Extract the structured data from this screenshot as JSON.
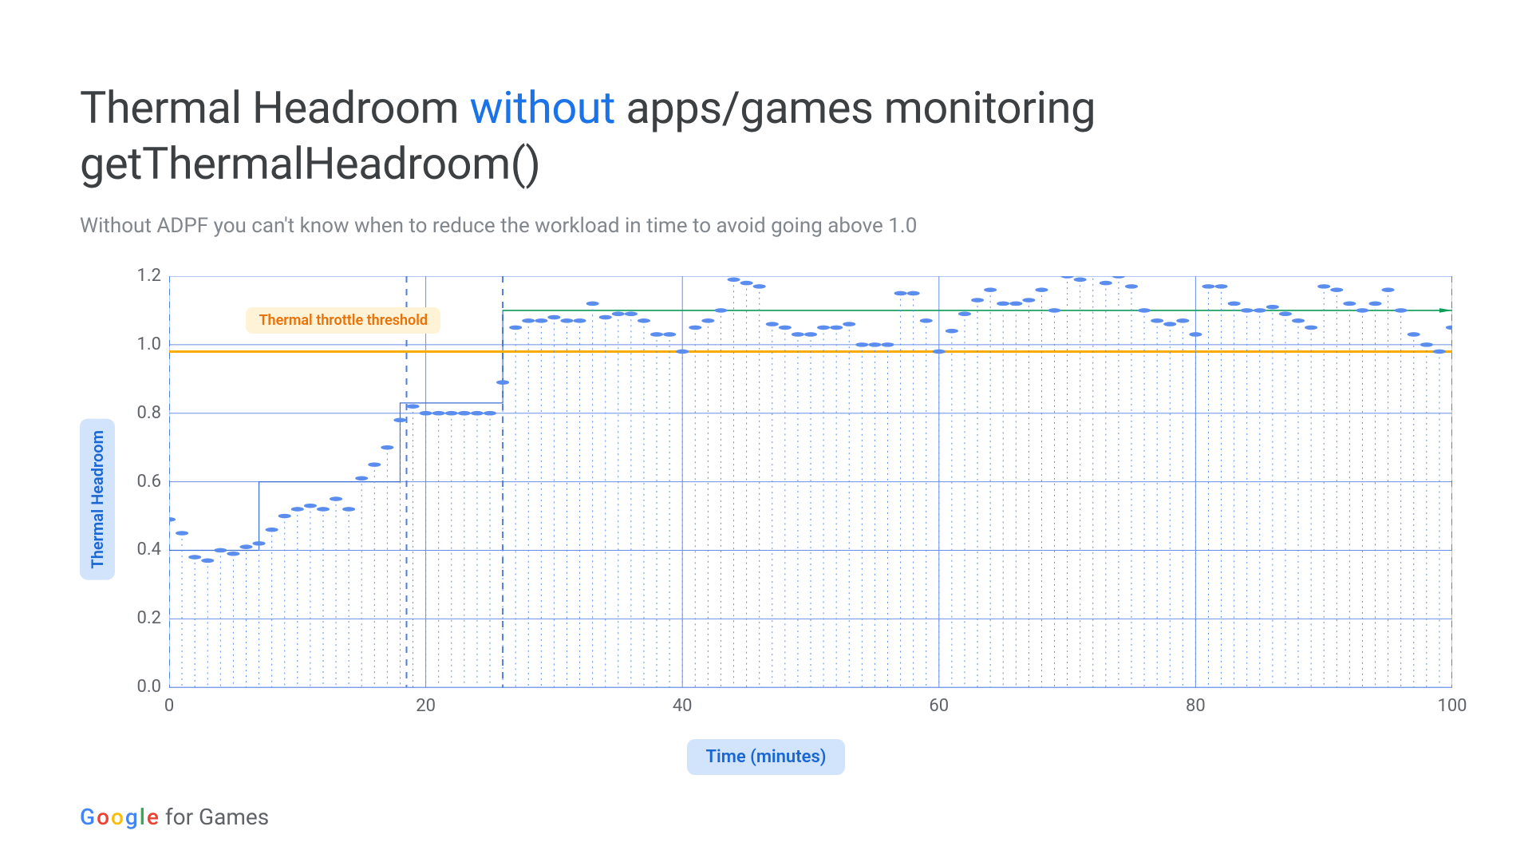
{
  "title_pre": "Thermal Headroom ",
  "title_accent": "without",
  "title_post": " apps/games monitoring getThermalHeadroom()",
  "subtitle": "Without ADPF you can't know when to reduce the workload in time to avoid going above 1.0",
  "ylabel": "Thermal Headroom",
  "xlabel": "Time (minutes)",
  "threshold_label": "Thermal throttle threshold",
  "footer_rest": "for Games",
  "chart_data": {
    "type": "scatter",
    "xlabel": "Time (minutes)",
    "ylabel": "Thermal Headroom",
    "xlim": [
      0,
      100
    ],
    "ylim": [
      0.0,
      1.2
    ],
    "xticks": [
      0,
      20,
      40,
      60,
      80,
      100
    ],
    "yticks": [
      0.0,
      0.2,
      0.4,
      0.6,
      0.8,
      1.0,
      1.2
    ],
    "threshold_y": 0.98,
    "threshold_label": "Thermal throttle threshold",
    "plateau_segments": [
      {
        "x0": 0,
        "x1": 7,
        "y": 0.4
      },
      {
        "x0": 7,
        "x1": 18,
        "y": 0.6
      },
      {
        "x0": 18,
        "x1": 26,
        "y": 0.83
      },
      {
        "x0": 26,
        "x1": 100,
        "y": 1.1
      }
    ],
    "region_markers_x": [
      0,
      18.5,
      26,
      100
    ],
    "x": [
      0,
      1,
      2,
      3,
      4,
      5,
      6,
      7,
      8,
      9,
      10,
      11,
      12,
      13,
      14,
      15,
      16,
      17,
      18,
      19,
      20,
      21,
      22,
      23,
      24,
      25,
      26,
      27,
      28,
      29,
      30,
      31,
      32,
      33,
      34,
      35,
      36,
      37,
      38,
      39,
      40,
      41,
      42,
      43,
      44,
      45,
      46,
      47,
      48,
      49,
      50,
      51,
      52,
      53,
      54,
      55,
      56,
      57,
      58,
      59,
      60,
      61,
      62,
      63,
      64,
      65,
      66,
      67,
      68,
      69,
      70,
      71,
      72,
      73,
      74,
      75,
      76,
      77,
      78,
      79,
      80,
      81,
      82,
      83,
      84,
      85,
      86,
      87,
      88,
      89,
      90,
      91,
      92,
      93,
      94,
      95,
      96,
      97,
      98,
      99,
      100
    ],
    "y": [
      0.49,
      0.45,
      0.38,
      0.37,
      0.4,
      0.39,
      0.41,
      0.42,
      0.46,
      0.5,
      0.52,
      0.53,
      0.52,
      0.55,
      0.52,
      0.61,
      0.65,
      0.7,
      0.78,
      0.82,
      0.8,
      0.8,
      0.8,
      0.8,
      0.8,
      0.8,
      0.89,
      1.05,
      1.07,
      1.07,
      1.08,
      1.07,
      1.07,
      1.12,
      1.08,
      1.09,
      1.09,
      1.07,
      1.03,
      1.03,
      0.98,
      1.05,
      1.07,
      1.1,
      1.19,
      1.18,
      1.17,
      1.06,
      1.05,
      1.03,
      1.03,
      1.05,
      1.05,
      1.06,
      1.0,
      1.0,
      1.0,
      1.15,
      1.15,
      1.07,
      0.98,
      1.04,
      1.09,
      1.13,
      1.16,
      1.12,
      1.12,
      1.13,
      1.16,
      1.1,
      1.2,
      1.19,
      1.21,
      1.18,
      1.2,
      1.17,
      1.1,
      1.07,
      1.06,
      1.07,
      1.03,
      1.17,
      1.17,
      1.12,
      1.1,
      1.1,
      1.11,
      1.09,
      1.07,
      1.05,
      1.17,
      1.16,
      1.12,
      1.1,
      1.12,
      1.16,
      1.1,
      1.03,
      1.0,
      0.98,
      1.05
    ]
  }
}
